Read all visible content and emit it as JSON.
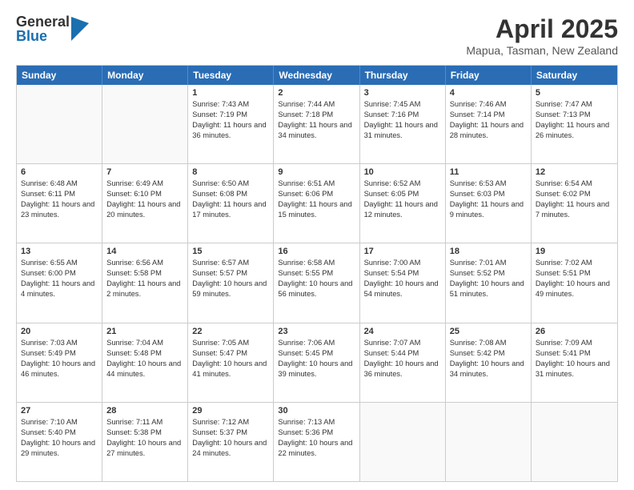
{
  "header": {
    "logo_general": "General",
    "logo_blue": "Blue",
    "title": "April 2025",
    "subtitle": "Mapua, Tasman, New Zealand"
  },
  "days": [
    "Sunday",
    "Monday",
    "Tuesday",
    "Wednesday",
    "Thursday",
    "Friday",
    "Saturday"
  ],
  "weeks": [
    [
      {
        "day": "",
        "empty": true
      },
      {
        "day": "",
        "empty": true
      },
      {
        "day": "1",
        "sunrise": "7:43 AM",
        "sunset": "7:19 PM",
        "daylight": "11 hours and 36 minutes."
      },
      {
        "day": "2",
        "sunrise": "7:44 AM",
        "sunset": "7:18 PM",
        "daylight": "11 hours and 34 minutes."
      },
      {
        "day": "3",
        "sunrise": "7:45 AM",
        "sunset": "7:16 PM",
        "daylight": "11 hours and 31 minutes."
      },
      {
        "day": "4",
        "sunrise": "7:46 AM",
        "sunset": "7:14 PM",
        "daylight": "11 hours and 28 minutes."
      },
      {
        "day": "5",
        "sunrise": "7:47 AM",
        "sunset": "7:13 PM",
        "daylight": "11 hours and 26 minutes."
      }
    ],
    [
      {
        "day": "6",
        "sunrise": "6:48 AM",
        "sunset": "6:11 PM",
        "daylight": "11 hours and 23 minutes."
      },
      {
        "day": "7",
        "sunrise": "6:49 AM",
        "sunset": "6:10 PM",
        "daylight": "11 hours and 20 minutes."
      },
      {
        "day": "8",
        "sunrise": "6:50 AM",
        "sunset": "6:08 PM",
        "daylight": "11 hours and 17 minutes."
      },
      {
        "day": "9",
        "sunrise": "6:51 AM",
        "sunset": "6:06 PM",
        "daylight": "11 hours and 15 minutes."
      },
      {
        "day": "10",
        "sunrise": "6:52 AM",
        "sunset": "6:05 PM",
        "daylight": "11 hours and 12 minutes."
      },
      {
        "day": "11",
        "sunrise": "6:53 AM",
        "sunset": "6:03 PM",
        "daylight": "11 hours and 9 minutes."
      },
      {
        "day": "12",
        "sunrise": "6:54 AM",
        "sunset": "6:02 PM",
        "daylight": "11 hours and 7 minutes."
      }
    ],
    [
      {
        "day": "13",
        "sunrise": "6:55 AM",
        "sunset": "6:00 PM",
        "daylight": "11 hours and 4 minutes."
      },
      {
        "day": "14",
        "sunrise": "6:56 AM",
        "sunset": "5:58 PM",
        "daylight": "11 hours and 2 minutes."
      },
      {
        "day": "15",
        "sunrise": "6:57 AM",
        "sunset": "5:57 PM",
        "daylight": "10 hours and 59 minutes."
      },
      {
        "day": "16",
        "sunrise": "6:58 AM",
        "sunset": "5:55 PM",
        "daylight": "10 hours and 56 minutes."
      },
      {
        "day": "17",
        "sunrise": "7:00 AM",
        "sunset": "5:54 PM",
        "daylight": "10 hours and 54 minutes."
      },
      {
        "day": "18",
        "sunrise": "7:01 AM",
        "sunset": "5:52 PM",
        "daylight": "10 hours and 51 minutes."
      },
      {
        "day": "19",
        "sunrise": "7:02 AM",
        "sunset": "5:51 PM",
        "daylight": "10 hours and 49 minutes."
      }
    ],
    [
      {
        "day": "20",
        "sunrise": "7:03 AM",
        "sunset": "5:49 PM",
        "daylight": "10 hours and 46 minutes."
      },
      {
        "day": "21",
        "sunrise": "7:04 AM",
        "sunset": "5:48 PM",
        "daylight": "10 hours and 44 minutes."
      },
      {
        "day": "22",
        "sunrise": "7:05 AM",
        "sunset": "5:47 PM",
        "daylight": "10 hours and 41 minutes."
      },
      {
        "day": "23",
        "sunrise": "7:06 AM",
        "sunset": "5:45 PM",
        "daylight": "10 hours and 39 minutes."
      },
      {
        "day": "24",
        "sunrise": "7:07 AM",
        "sunset": "5:44 PM",
        "daylight": "10 hours and 36 minutes."
      },
      {
        "day": "25",
        "sunrise": "7:08 AM",
        "sunset": "5:42 PM",
        "daylight": "10 hours and 34 minutes."
      },
      {
        "day": "26",
        "sunrise": "7:09 AM",
        "sunset": "5:41 PM",
        "daylight": "10 hours and 31 minutes."
      }
    ],
    [
      {
        "day": "27",
        "sunrise": "7:10 AM",
        "sunset": "5:40 PM",
        "daylight": "10 hours and 29 minutes."
      },
      {
        "day": "28",
        "sunrise": "7:11 AM",
        "sunset": "5:38 PM",
        "daylight": "10 hours and 27 minutes."
      },
      {
        "day": "29",
        "sunrise": "7:12 AM",
        "sunset": "5:37 PM",
        "daylight": "10 hours and 24 minutes."
      },
      {
        "day": "30",
        "sunrise": "7:13 AM",
        "sunset": "5:36 PM",
        "daylight": "10 hours and 22 minutes."
      },
      {
        "day": "",
        "empty": true
      },
      {
        "day": "",
        "empty": true
      },
      {
        "day": "",
        "empty": true
      }
    ]
  ]
}
